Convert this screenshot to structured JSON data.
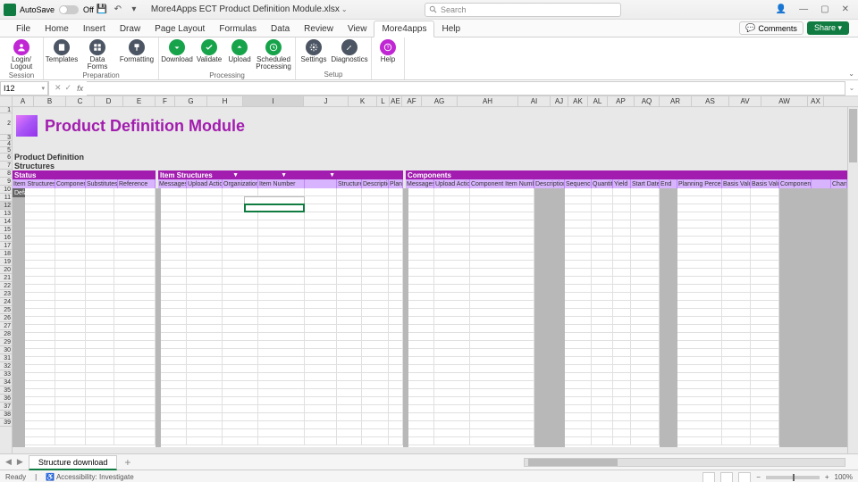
{
  "titlebar": {
    "autosave": "AutoSave",
    "autosave_off": "Off",
    "filename": "More4Apps ECT Product Definition Module.xlsx"
  },
  "search": {
    "placeholder": "Search"
  },
  "window": {
    "user": "",
    "min": "—",
    "max": "▢",
    "close": "✕"
  },
  "tabs": [
    "File",
    "Home",
    "Insert",
    "Draw",
    "Page Layout",
    "Formulas",
    "Data",
    "Review",
    "View",
    "More4apps",
    "Help"
  ],
  "active_tab": 9,
  "comments": "Comments",
  "share": "Share",
  "ribbon": {
    "groups": [
      {
        "name": "Session",
        "buttons": [
          {
            "label": "Login/\nLogout",
            "color": "#c026d3",
            "icon": "user"
          }
        ]
      },
      {
        "name": "Preparation",
        "buttons": [
          {
            "label": "Templates",
            "color": "#4b5563",
            "icon": "doc"
          },
          {
            "label": "Data\nForms",
            "color": "#4b5563",
            "icon": "grid"
          },
          {
            "label": "Formatting",
            "color": "#4b5563",
            "icon": "paint"
          }
        ]
      },
      {
        "name": "Processing",
        "buttons": [
          {
            "label": "Download",
            "color": "#16a34a",
            "icon": "down"
          },
          {
            "label": "Validate",
            "color": "#16a34a",
            "icon": "check"
          },
          {
            "label": "Upload",
            "color": "#16a34a",
            "icon": "up"
          },
          {
            "label": "Scheduled\nProcessing",
            "color": "#16a34a",
            "icon": "clock"
          }
        ]
      },
      {
        "name": "Setup",
        "buttons": [
          {
            "label": "Settings",
            "color": "#4b5563",
            "icon": "gear"
          },
          {
            "label": "Diagnostics",
            "color": "#4b5563",
            "icon": "wrench"
          }
        ]
      },
      {
        "name": "",
        "buttons": [
          {
            "label": "Help",
            "color": "#c026d3",
            "icon": "help"
          }
        ]
      }
    ]
  },
  "namebox": "I12",
  "columns": [
    {
      "l": "A",
      "w": 24
    },
    {
      "l": "B",
      "w": 36
    },
    {
      "l": "C",
      "w": 32
    },
    {
      "l": "D",
      "w": 32
    },
    {
      "l": "E",
      "w": 36
    },
    {
      "l": "F",
      "w": 22
    },
    {
      "l": "G",
      "w": 36
    },
    {
      "l": "H",
      "w": 40
    },
    {
      "l": "I",
      "w": 68
    },
    {
      "l": "J",
      "w": 50
    },
    {
      "l": "K",
      "w": 32
    },
    {
      "l": "L",
      "w": 14
    },
    {
      "l": "AE",
      "w": 14
    },
    {
      "l": "AF",
      "w": 22
    },
    {
      "l": "AG",
      "w": 40
    },
    {
      "l": "AH",
      "w": 68
    },
    {
      "l": "AI",
      "w": 36
    },
    {
      "l": "AJ",
      "w": 20
    },
    {
      "l": "AK",
      "w": 22
    },
    {
      "l": "AL",
      "w": 22
    },
    {
      "l": "AP",
      "w": 30
    },
    {
      "l": "AQ",
      "w": 28
    },
    {
      "l": "AR",
      "w": 36
    },
    {
      "l": "AS",
      "w": 42
    },
    {
      "l": "AV",
      "w": 36
    },
    {
      "l": "AW",
      "w": 52
    },
    {
      "l": "AX",
      "w": 18
    }
  ],
  "rows": 39,
  "module_title": "Product Definition Module",
  "labels": {
    "pd": "Product Definition",
    "str": "Structures",
    "defvals": "Default Values"
  },
  "section1": {
    "status": "Status",
    "sub": [
      "Item Structures",
      "Component",
      "Substitutes",
      "Reference"
    ]
  },
  "section2": {
    "title": "Item Structures",
    "sub": [
      "Messages",
      "Upload Action",
      "Organization",
      "Item Number",
      "",
      "Structure",
      "Description",
      "Plan Level"
    ]
  },
  "section3": {
    "title": "Components",
    "sub": [
      "Messages",
      "Upload Action",
      "Component Item Number",
      "Description",
      "Sequence",
      "Quantity",
      "Yield",
      "Start Date",
      "End",
      "Planning Percent",
      "Basis Value",
      "Basis Value",
      "Component Path",
      "",
      "Change"
    ]
  },
  "sheet_tabs": {
    "active": "Structure download"
  },
  "status": {
    "ready": "Ready",
    "acc": "Accessibility: Investigate",
    "zoom": "100%"
  }
}
